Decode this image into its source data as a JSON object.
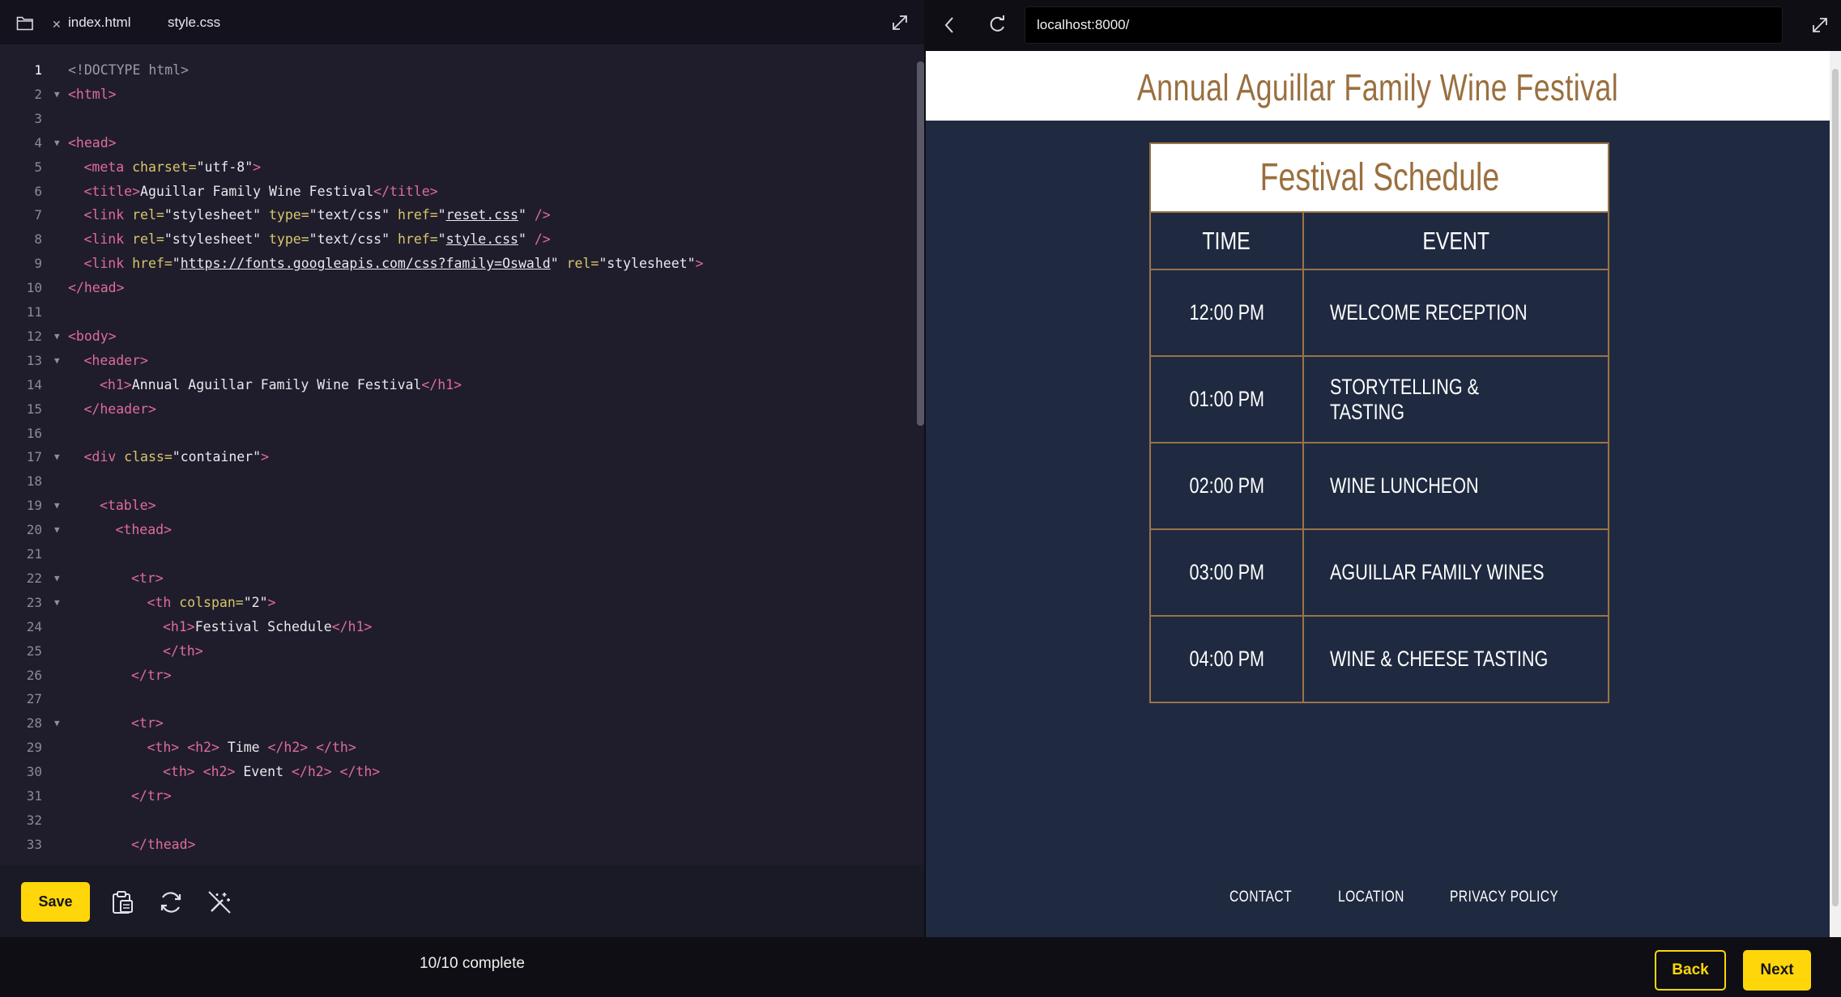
{
  "editor": {
    "tabs": [
      {
        "label": "index.html",
        "active": true
      },
      {
        "label": "style.css",
        "active": false
      }
    ],
    "save_label": "Save",
    "lines": [
      {
        "n": "1",
        "indent": 0,
        "fold": false,
        "parts": [
          [
            "dim",
            "<!DOCTYPE html>"
          ]
        ]
      },
      {
        "n": "2",
        "indent": 0,
        "fold": true,
        "parts": [
          [
            "tg",
            "<html>"
          ]
        ]
      },
      {
        "n": "3",
        "indent": 0,
        "fold": false,
        "parts": []
      },
      {
        "n": "4",
        "indent": 0,
        "fold": true,
        "parts": [
          [
            "tg",
            "<head>"
          ]
        ]
      },
      {
        "n": "5",
        "indent": 1,
        "fold": false,
        "parts": [
          [
            "tg",
            "<meta "
          ],
          [
            "at",
            "charset="
          ],
          [
            "st",
            "\"utf-8\""
          ],
          [
            "tg",
            ">"
          ]
        ]
      },
      {
        "n": "6",
        "indent": 1,
        "fold": false,
        "parts": [
          [
            "tg",
            "<title>"
          ],
          [
            "st",
            "Aguillar Family Wine Festival"
          ],
          [
            "tg",
            "</title>"
          ]
        ]
      },
      {
        "n": "7",
        "indent": 1,
        "fold": false,
        "parts": [
          [
            "tg",
            "<link "
          ],
          [
            "at",
            "rel="
          ],
          [
            "st",
            "\"stylesheet\" "
          ],
          [
            "at",
            "type="
          ],
          [
            "st",
            "\"text/css\" "
          ],
          [
            "at",
            "href="
          ],
          [
            "st",
            "\""
          ],
          [
            "ul",
            "reset.css"
          ],
          [
            "st",
            "\" "
          ],
          [
            "tg",
            "/>"
          ]
        ]
      },
      {
        "n": "8",
        "indent": 1,
        "fold": false,
        "parts": [
          [
            "tg",
            "<link "
          ],
          [
            "at",
            "rel="
          ],
          [
            "st",
            "\"stylesheet\" "
          ],
          [
            "at",
            "type="
          ],
          [
            "st",
            "\"text/css\" "
          ],
          [
            "at",
            "href="
          ],
          [
            "st",
            "\""
          ],
          [
            "ul",
            "style.css"
          ],
          [
            "st",
            "\" "
          ],
          [
            "tg",
            "/>"
          ]
        ]
      },
      {
        "n": "9",
        "indent": 1,
        "fold": false,
        "parts": [
          [
            "tg",
            "<link "
          ],
          [
            "at",
            "href="
          ],
          [
            "st",
            "\""
          ],
          [
            "ul",
            "https://fonts.googleapis.com/css?family=Oswald"
          ],
          [
            "st",
            "\" "
          ],
          [
            "at",
            "rel="
          ],
          [
            "st",
            "\"stylesheet\""
          ],
          [
            "tg",
            ">"
          ]
        ]
      },
      {
        "n": "10",
        "indent": 0,
        "fold": false,
        "parts": [
          [
            "tg",
            "</head>"
          ]
        ]
      },
      {
        "n": "11",
        "indent": 0,
        "fold": false,
        "parts": []
      },
      {
        "n": "12",
        "indent": 0,
        "fold": true,
        "parts": [
          [
            "tg",
            "<body>"
          ]
        ]
      },
      {
        "n": "13",
        "indent": 1,
        "fold": true,
        "parts": [
          [
            "tg",
            "<header>"
          ]
        ]
      },
      {
        "n": "14",
        "indent": 2,
        "fold": false,
        "parts": [
          [
            "tg",
            "<h1>"
          ],
          [
            "st",
            "Annual Aguillar Family Wine Festival"
          ],
          [
            "tg",
            "</h1>"
          ]
        ]
      },
      {
        "n": "15",
        "indent": 1,
        "fold": false,
        "parts": [
          [
            "tg",
            "</header>"
          ]
        ]
      },
      {
        "n": "16",
        "indent": 0,
        "fold": false,
        "parts": []
      },
      {
        "n": "17",
        "indent": 1,
        "fold": true,
        "parts": [
          [
            "tg",
            "<div "
          ],
          [
            "at",
            "class="
          ],
          [
            "st",
            "\"container\""
          ],
          [
            "tg",
            ">"
          ]
        ]
      },
      {
        "n": "18",
        "indent": 0,
        "fold": false,
        "parts": []
      },
      {
        "n": "19",
        "indent": 2,
        "fold": true,
        "parts": [
          [
            "tg",
            "<table>"
          ]
        ]
      },
      {
        "n": "20",
        "indent": 3,
        "fold": true,
        "parts": [
          [
            "tg",
            "<thead>"
          ]
        ]
      },
      {
        "n": "21",
        "indent": 0,
        "fold": false,
        "parts": []
      },
      {
        "n": "22",
        "indent": 4,
        "fold": true,
        "parts": [
          [
            "tg",
            "<tr>"
          ]
        ]
      },
      {
        "n": "23",
        "indent": 5,
        "fold": true,
        "parts": [
          [
            "tg",
            "<th "
          ],
          [
            "at",
            "colspan="
          ],
          [
            "st",
            "\"2\""
          ],
          [
            "tg",
            ">"
          ]
        ]
      },
      {
        "n": "24",
        "indent": 6,
        "fold": false,
        "parts": [
          [
            "tg",
            "<h1>"
          ],
          [
            "st",
            "Festival Schedule"
          ],
          [
            "tg",
            "</h1>"
          ]
        ]
      },
      {
        "n": "25",
        "indent": 6,
        "fold": false,
        "parts": [
          [
            "tg",
            "</th>"
          ]
        ]
      },
      {
        "n": "26",
        "indent": 4,
        "fold": false,
        "parts": [
          [
            "tg",
            "</tr>"
          ]
        ]
      },
      {
        "n": "27",
        "indent": 0,
        "fold": false,
        "parts": []
      },
      {
        "n": "28",
        "indent": 4,
        "fold": true,
        "parts": [
          [
            "tg",
            "<tr>"
          ]
        ]
      },
      {
        "n": "29",
        "indent": 5,
        "fold": false,
        "parts": [
          [
            "tg",
            "<th> <h2> "
          ],
          [
            "st",
            "Time "
          ],
          [
            "tg",
            "</h2> </th>"
          ]
        ]
      },
      {
        "n": "30",
        "indent": 6,
        "fold": false,
        "parts": [
          [
            "tg",
            "<th> <h2> "
          ],
          [
            "st",
            "Event "
          ],
          [
            "tg",
            "</h2> </th>"
          ]
        ]
      },
      {
        "n": "31",
        "indent": 4,
        "fold": false,
        "parts": [
          [
            "tg",
            "</tr>"
          ]
        ]
      },
      {
        "n": "32",
        "indent": 0,
        "fold": false,
        "parts": []
      },
      {
        "n": "33",
        "indent": 4,
        "fold": false,
        "parts": [
          [
            "tg",
            "</thead>"
          ]
        ]
      }
    ]
  },
  "browser": {
    "url": "localhost:8000/"
  },
  "site": {
    "title": "Annual Aguillar Family Wine Festival",
    "table_caption": "Festival Schedule",
    "col_time": "TIME",
    "col_event": "EVENT",
    "rows": [
      {
        "time": "12:00 PM",
        "event": "WELCOME RECEPTION"
      },
      {
        "time": "01:00 PM",
        "event": "STORYTELLING & TASTING"
      },
      {
        "time": "02:00 PM",
        "event": "WINE LUNCHEON"
      },
      {
        "time": "03:00 PM",
        "event": "AGUILLAR FAMILY WINES"
      },
      {
        "time": "04:00 PM",
        "event": "WINE & CHEESE TASTING"
      }
    ],
    "footer": {
      "contact": "CONTACT",
      "location": "LOCATION",
      "privacy": "PRIVACY POLICY"
    }
  },
  "bottom": {
    "progress": "10/10 complete",
    "back_label": "Back",
    "next_label": "Next"
  },
  "colors": {
    "accent": "#ffd60a",
    "site_gold": "#9a6f3e",
    "site_bg": "#1f2a40"
  }
}
